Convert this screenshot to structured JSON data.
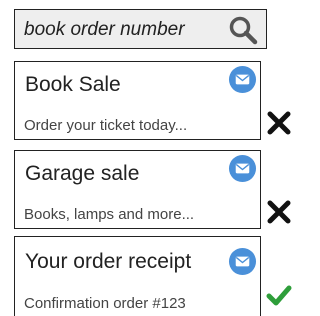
{
  "search": {
    "query": "book order number",
    "icon": "search-icon"
  },
  "emails": [
    {
      "title": "Book Sale",
      "preview": "Order your ticket today...",
      "icon": "mail-icon",
      "status": "cross"
    },
    {
      "title": "Garage sale",
      "preview": "Books, lamps and more...",
      "icon": "mail-icon",
      "status": "cross"
    },
    {
      "title": "Your order receipt",
      "preview": "Confirmation order #123",
      "icon": "mail-icon",
      "status": "check"
    }
  ],
  "colors": {
    "mail_icon_fill": "#4a90d9",
    "check": "#2e9e3a",
    "cross": "#111111",
    "search_bg": "#eeeeee"
  }
}
